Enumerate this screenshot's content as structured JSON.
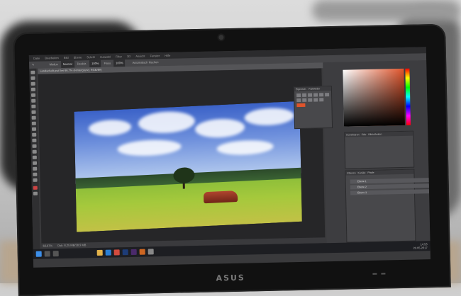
{
  "app": {
    "menu": [
      "Datei",
      "Bearbeiten",
      "Bild",
      "Ebene",
      "Schrift",
      "Auswahl",
      "Filter",
      "3D",
      "Ansicht",
      "Fenster",
      "Hilfe"
    ],
    "options": {
      "modus_label": "Modus",
      "modus_value": "Normal",
      "deckkraft_label": "Deckkr.",
      "deckkraft_value": "100%",
      "fluss_label": "Fluss",
      "fluss_value": "100%",
      "airbrush_label": "Automatisch löschen"
    },
    "document_tab": "Landschaft.psd bei 66,7% (Hintergrund, RGB/8#)",
    "status_zoom": "66,67%",
    "status_doc": "Dok: 8,25 MB/28,9 MB",
    "panels": {
      "properties_tabs": [
        "Eigensch.",
        "Farbfelder"
      ],
      "adjust_tabs": [
        "Korrekturen",
        "Stile",
        "Bibliotheken"
      ],
      "layers_tabs": [
        "Ebenen",
        "Kanäle",
        "Pfade"
      ],
      "layers": [
        "Ebene 1",
        "Ebene 2",
        "Ebene 3"
      ]
    }
  },
  "taskbar": {
    "time": "14:53",
    "date": "23.05.2017"
  },
  "laptop_brand": "ASUS",
  "colors": {
    "accent": "#e0542b",
    "ps_dark": "#2b2b2d",
    "ps_panel": "#48484b"
  }
}
